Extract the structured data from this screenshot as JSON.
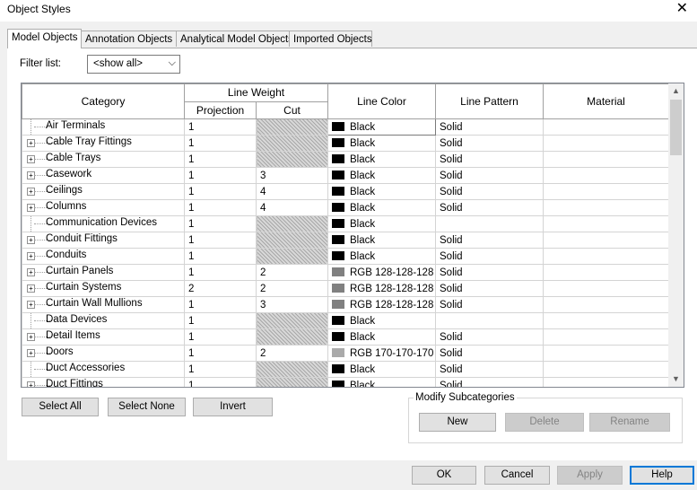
{
  "window": {
    "title": "Object Styles"
  },
  "tabs": [
    {
      "label": "Model Objects"
    },
    {
      "label": "Annotation Objects"
    },
    {
      "label": "Analytical Model Objects"
    },
    {
      "label": "Imported Objects"
    }
  ],
  "filter": {
    "label": "Filter list:",
    "value": "<show all>"
  },
  "table": {
    "headers": {
      "category": "Category",
      "line_weight": "Line Weight",
      "projection": "Projection",
      "cut": "Cut",
      "line_color": "Line Color",
      "line_pattern": "Line Pattern",
      "material": "Material"
    },
    "rows": [
      {
        "name": "Air Terminals",
        "expand": false,
        "projection": "1",
        "cut": "",
        "color": "Black",
        "swatch": "#000000",
        "pattern": "Solid"
      },
      {
        "name": "Cable Tray Fittings",
        "expand": true,
        "projection": "1",
        "cut": "",
        "color": "Black",
        "swatch": "#000000",
        "pattern": "Solid"
      },
      {
        "name": "Cable Trays",
        "expand": true,
        "projection": "1",
        "cut": "",
        "color": "Black",
        "swatch": "#000000",
        "pattern": "Solid"
      },
      {
        "name": "Casework",
        "expand": true,
        "projection": "1",
        "cut": "3",
        "color": "Black",
        "swatch": "#000000",
        "pattern": "Solid"
      },
      {
        "name": "Ceilings",
        "expand": true,
        "projection": "1",
        "cut": "4",
        "color": "Black",
        "swatch": "#000000",
        "pattern": "Solid"
      },
      {
        "name": "Columns",
        "expand": true,
        "projection": "1",
        "cut": "4",
        "color": "Black",
        "swatch": "#000000",
        "pattern": "Solid"
      },
      {
        "name": "Communication Devices",
        "expand": false,
        "projection": "1",
        "cut": "",
        "color": "Black",
        "swatch": "#000000",
        "pattern": ""
      },
      {
        "name": "Conduit Fittings",
        "expand": true,
        "projection": "1",
        "cut": "",
        "color": "Black",
        "swatch": "#000000",
        "pattern": "Solid"
      },
      {
        "name": "Conduits",
        "expand": true,
        "projection": "1",
        "cut": "",
        "color": "Black",
        "swatch": "#000000",
        "pattern": "Solid"
      },
      {
        "name": "Curtain Panels",
        "expand": true,
        "projection": "1",
        "cut": "2",
        "color": "RGB 128-128-128",
        "swatch": "#808080",
        "pattern": "Solid"
      },
      {
        "name": "Curtain Systems",
        "expand": true,
        "projection": "2",
        "cut": "2",
        "color": "RGB 128-128-128",
        "swatch": "#808080",
        "pattern": "Solid"
      },
      {
        "name": "Curtain Wall Mullions",
        "expand": true,
        "projection": "1",
        "cut": "3",
        "color": "RGB 128-128-128",
        "swatch": "#808080",
        "pattern": "Solid"
      },
      {
        "name": "Data Devices",
        "expand": false,
        "projection": "1",
        "cut": "",
        "color": "Black",
        "swatch": "#000000",
        "pattern": ""
      },
      {
        "name": "Detail Items",
        "expand": true,
        "projection": "1",
        "cut": "",
        "color": "Black",
        "swatch": "#000000",
        "pattern": "Solid"
      },
      {
        "name": "Doors",
        "expand": true,
        "projection": "1",
        "cut": "2",
        "color": "RGB 170-170-170",
        "swatch": "#aaaaaa",
        "pattern": "Solid"
      },
      {
        "name": "Duct Accessories",
        "expand": false,
        "projection": "1",
        "cut": "",
        "color": "Black",
        "swatch": "#000000",
        "pattern": "Solid"
      },
      {
        "name": "Duct Fittings",
        "expand": true,
        "projection": "1",
        "cut": "",
        "color": "Black",
        "swatch": "#000000",
        "pattern": "Solid"
      }
    ]
  },
  "buttons": {
    "select_all": "Select All",
    "select_none": "Select None",
    "invert": "Invert"
  },
  "subcategories": {
    "label": "Modify Subcategories",
    "new": "New",
    "delete": "Delete",
    "rename": "Rename"
  },
  "footer": {
    "ok": "OK",
    "cancel": "Cancel",
    "apply": "Apply",
    "help": "Help"
  }
}
